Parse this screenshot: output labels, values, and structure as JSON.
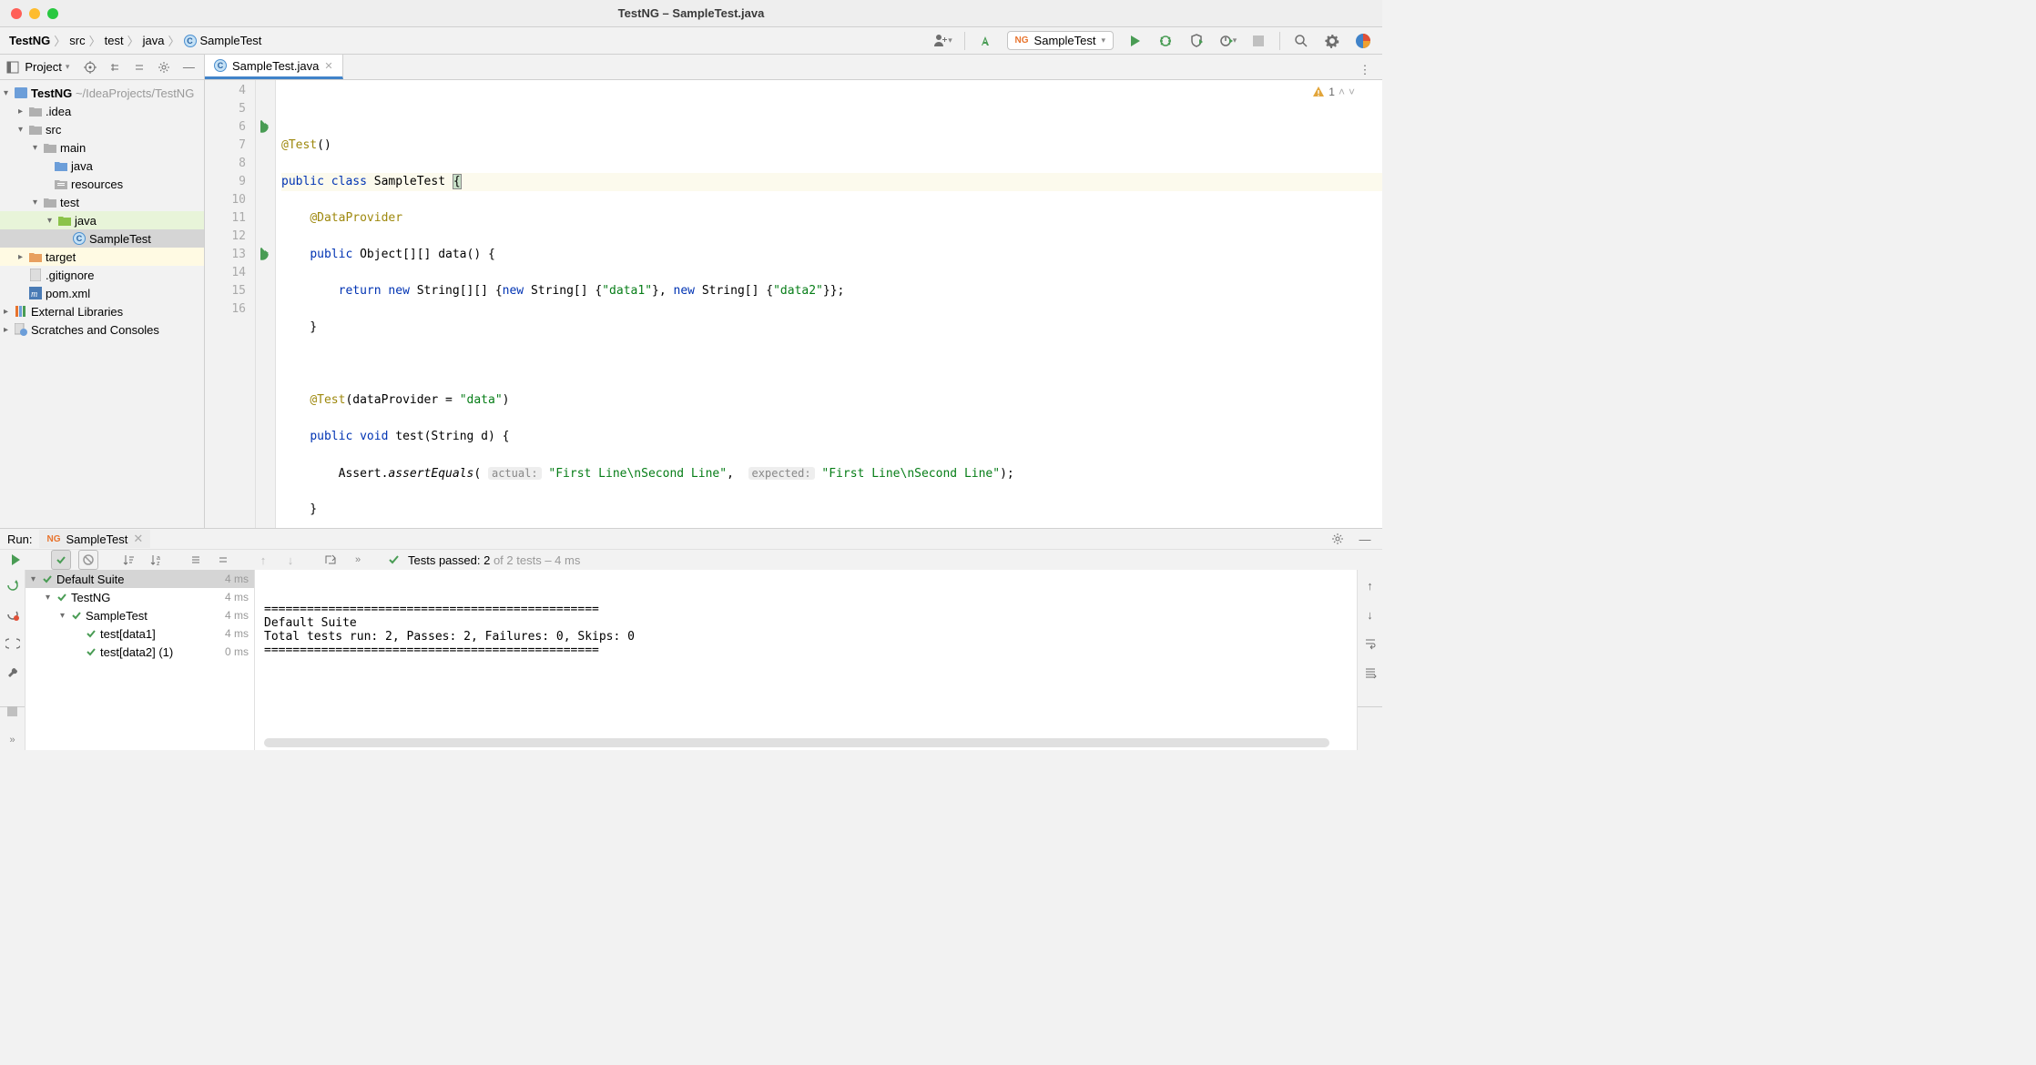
{
  "window": {
    "title": "TestNG – SampleTest.java"
  },
  "breadcrumb": [
    "TestNG",
    "src",
    "test",
    "java",
    "SampleTest"
  ],
  "run_config": {
    "label": "SampleTest"
  },
  "project_panel": {
    "title": "Project",
    "root": {
      "name": "TestNG",
      "path": "~/IdeaProjects/TestNG"
    },
    "nodes": {
      "idea": ".idea",
      "src": "src",
      "main": "main",
      "java_main": "java",
      "resources": "resources",
      "test": "test",
      "java_test": "java",
      "sample_test": "SampleTest",
      "target": "target",
      "gitignore": ".gitignore",
      "pom": "pom.xml",
      "ext_lib": "External Libraries",
      "scratches": "Scratches and Consoles"
    }
  },
  "editor": {
    "tab": "SampleTest.java",
    "warning_count": "1",
    "lines": {
      "start": 4,
      "end": 16
    },
    "code": {
      "l5": {
        "ann": "@Test",
        "rest": "()"
      },
      "l6": {
        "kw1": "public",
        "kw2": "class",
        "cls": "SampleTest",
        "brace": "{"
      },
      "l7": {
        "ann": "@DataProvider"
      },
      "l8": {
        "kw": "public",
        "txt": " Object[][] ",
        "mth": "data",
        "rest": "() {"
      },
      "l9": {
        "kw1": "return",
        "kw2": "new",
        "txt1": " String[][] {",
        "kw3": "new",
        "txt2": " String[] {",
        "s1": "\"data1\"",
        "txt3": "}, ",
        "kw4": "new",
        "txt4": " String[] {",
        "s2": "\"data2\"",
        "txt5": "}};"
      },
      "l10": "    }",
      "l12": {
        "ann": "@Test",
        "txt1": "(dataProvider = ",
        "s1": "\"data\"",
        "txt2": ")"
      },
      "l13": {
        "kw1": "public",
        "kw2": "void",
        "mth": "test",
        "txt": "(String d) {"
      },
      "l14": {
        "txt1": "        Assert.",
        "mth": "assertEquals",
        "txt2": "( ",
        "h1": "actual:",
        "sp1": " ",
        "s1": "\"First Line\\nSecond Line\"",
        "txt3": ",  ",
        "h2": "expected:",
        "sp2": " ",
        "s2": "\"First Line\\nSecond Line\"",
        "txt4": ");"
      },
      "l15": "    }",
      "l16": "}"
    }
  },
  "run_panel": {
    "label": "Run:",
    "tab": "SampleTest",
    "tests_passed_prefix": "Tests passed: ",
    "tests_passed_count": "2",
    "tests_passed_suffix": " of 2 tests – 4 ms",
    "tree": [
      {
        "name": "Default Suite",
        "time": "4 ms",
        "indent": 0,
        "expanded": true,
        "sel": true
      },
      {
        "name": "TestNG",
        "time": "4 ms",
        "indent": 1,
        "expanded": true
      },
      {
        "name": "SampleTest",
        "time": "4 ms",
        "indent": 2,
        "expanded": true
      },
      {
        "name": "test[data1]",
        "time": "4 ms",
        "indent": 3
      },
      {
        "name": "test[data2] (1)",
        "time": "0 ms",
        "indent": 3
      }
    ],
    "output": "\n===============================================\nDefault Suite\nTotal tests run: 2, Passes: 2, Failures: 0, Skips: 0\n===============================================\n"
  }
}
